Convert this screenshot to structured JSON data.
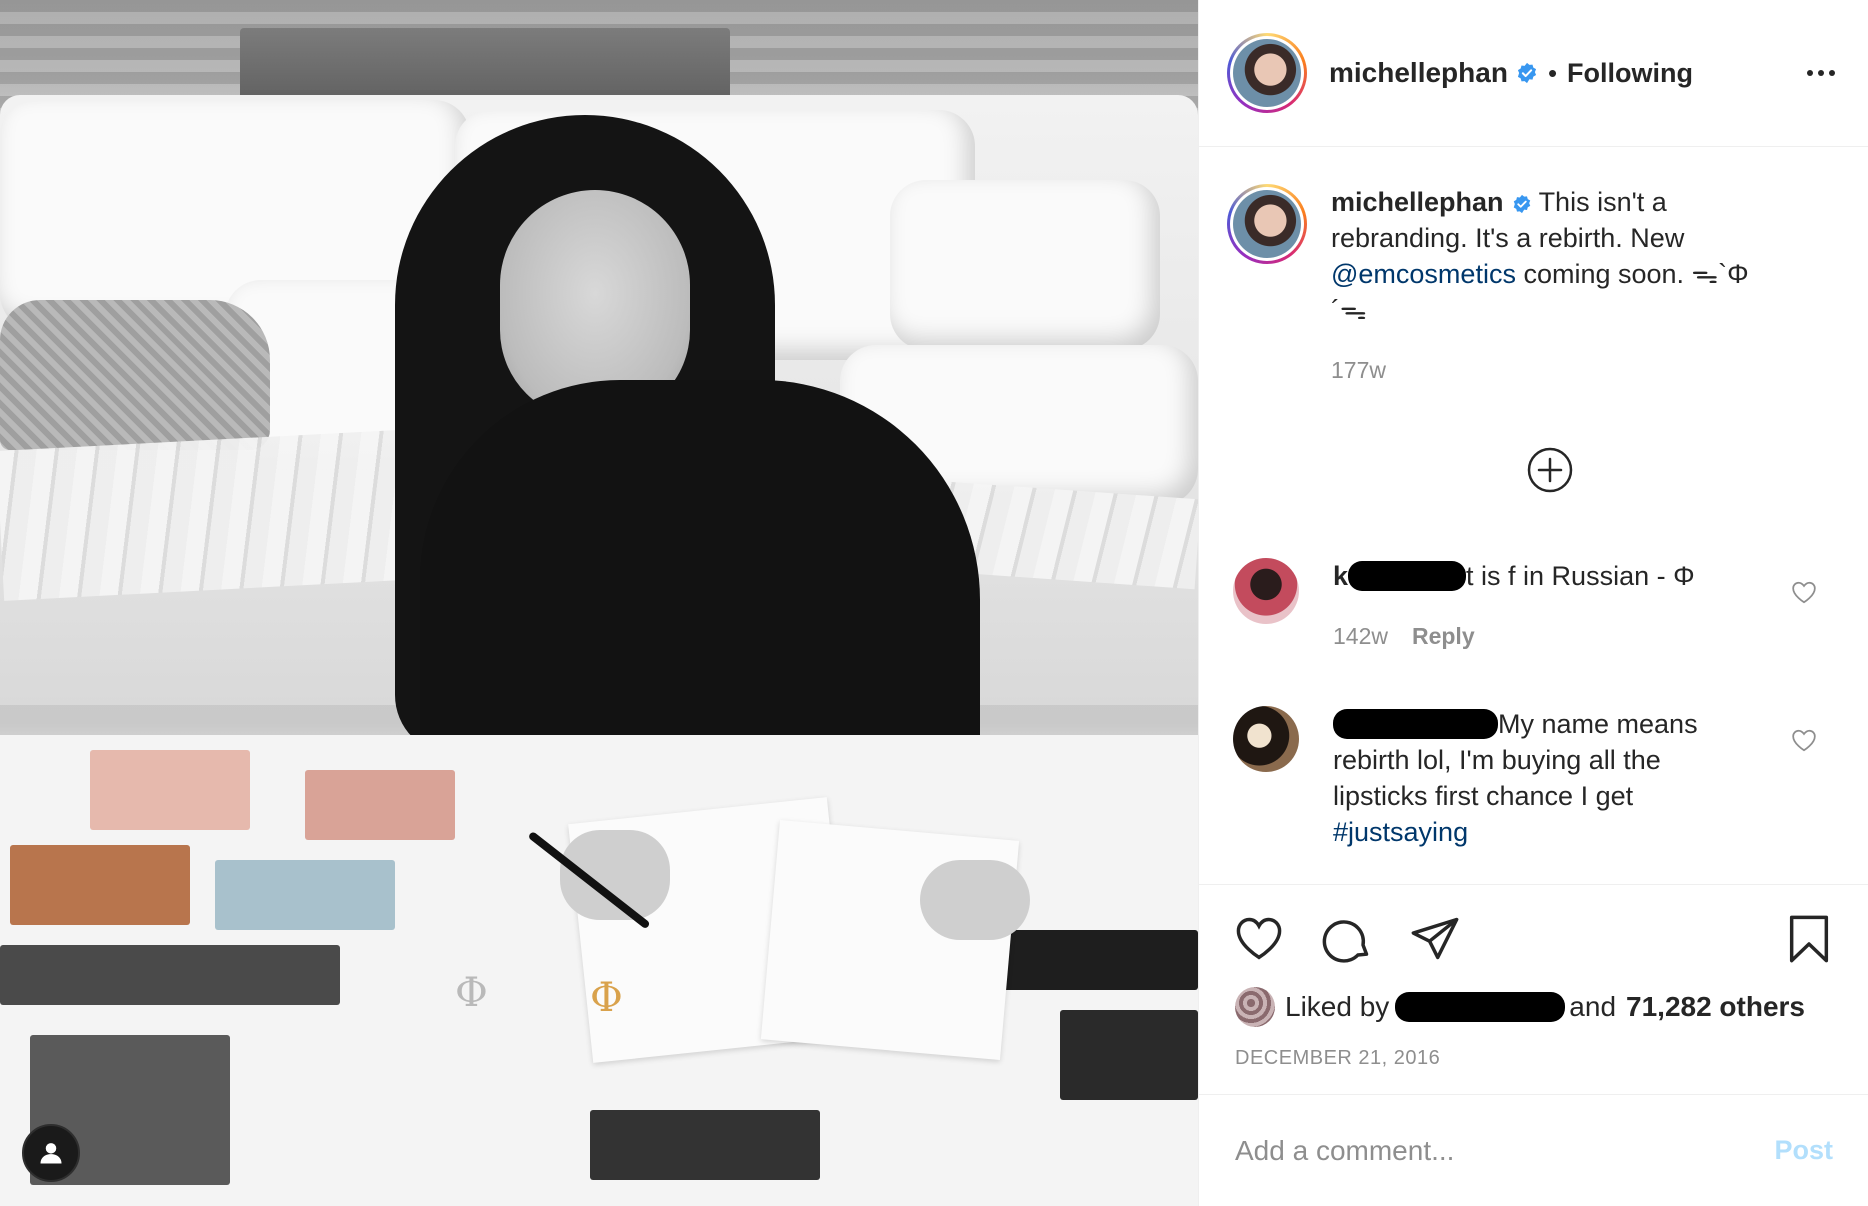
{
  "header": {
    "username": "michellephan",
    "separator": "•",
    "follow_status": "Following",
    "more_icon": "more-horizontal-icon"
  },
  "caption": {
    "username": "michellephan",
    "text_before_mention": "This isn't a rebranding. It's a rebirth. New",
    "mention": "@emcosmetics",
    "text_after_mention": "coming soon. ᯓ`Φ´ᯓ",
    "time": "177w"
  },
  "comments": [
    {
      "username_visible_prefix": "k",
      "text": "t is f in Russian - Φ",
      "time": "142w",
      "reply_label": "Reply"
    },
    {
      "text": "My name means rebirth lol, I'm buying all the lipsticks first chance I get",
      "hashtag": "#justsaying"
    }
  ],
  "actions": {
    "like_icon": "heart-icon",
    "comment_icon": "comment-icon",
    "share_icon": "paper-plane-icon",
    "save_icon": "bookmark-icon"
  },
  "likes": {
    "prefix": "Liked by",
    "conjunction": "and",
    "others": "71,282 others"
  },
  "post_date": "DECEMBER 21, 2016",
  "add_comment": {
    "placeholder": "Add a comment...",
    "post_label": "Post"
  },
  "colors": {
    "text": "#262626",
    "muted": "#8e8e8e",
    "link": "#00376b",
    "verified": "#3897f0",
    "post_disabled": "#b2dffc"
  }
}
